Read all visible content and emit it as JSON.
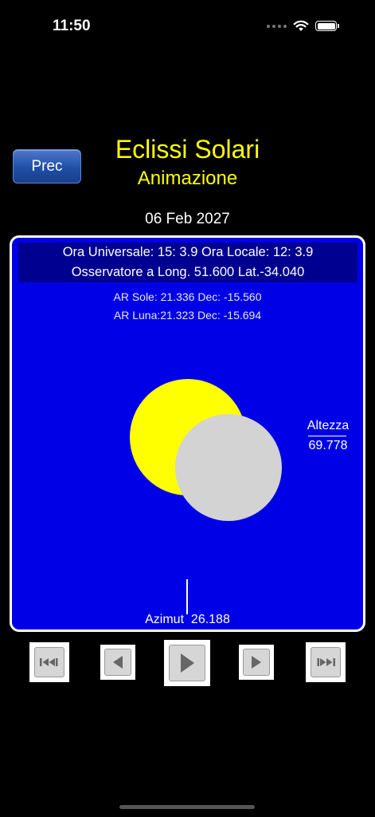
{
  "status": {
    "time": "11:50"
  },
  "header": {
    "prev_label": "Prec",
    "title": "Eclissi Solari",
    "subtitle": "Animazione",
    "date": "06 Feb 2027"
  },
  "panel": {
    "time_line": "Ora Universale: 15: 3.9 Ora Locale: 12: 3.9",
    "observer_line": "Osservatore a Long. 51.600 Lat.-34.040",
    "sun_line": "AR Sole: 21.336 Dec: -15.560",
    "moon_line": "AR Luna:21.323 Dec: -15.694",
    "altitude_label": "Altezza",
    "altitude_value": "69.778",
    "azimuth_text": "Azimut  26.188"
  },
  "controls": [
    {
      "icon": "skip-first-icon"
    },
    {
      "icon": "step-back-icon"
    },
    {
      "icon": "play-icon"
    },
    {
      "icon": "step-forward-icon"
    },
    {
      "icon": "skip-last-icon"
    }
  ],
  "colors": {
    "background": "#000000",
    "panel": "#0000e6",
    "infobar": "#000090",
    "title": "#ffff00",
    "sun": "#ffff00",
    "moon": "#d3d3d3",
    "button": "#1f4fa6"
  }
}
